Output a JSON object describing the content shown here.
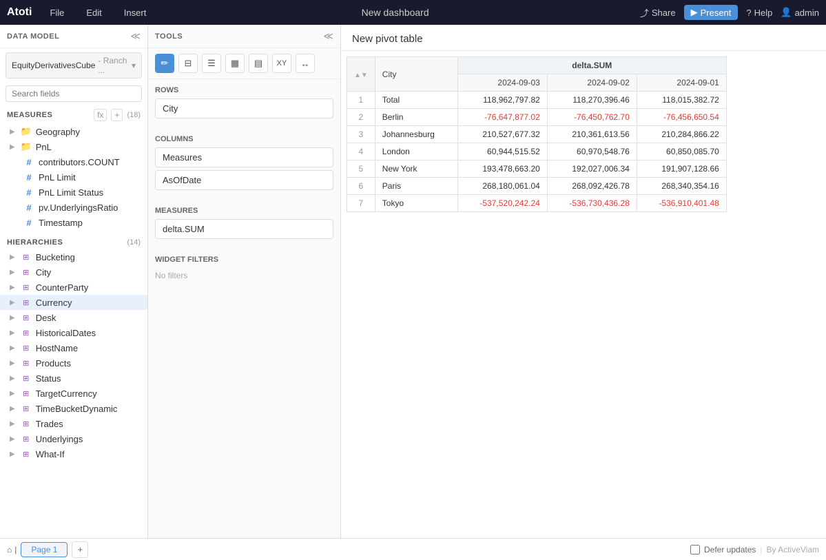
{
  "app": {
    "logo": "Atoti",
    "menu_items": [
      "File",
      "Edit",
      "Insert"
    ],
    "dashboard_title": "New dashboard",
    "share_label": "Share",
    "present_label": "Present",
    "help_label": "Help",
    "user_label": "admin"
  },
  "left_panel": {
    "title": "DATA MODEL",
    "cube_name": "EquityDerivativesCube",
    "cube_suffix": "- Ranch ...",
    "search_placeholder": "Search fields",
    "measures_section": {
      "label": "MEASURES",
      "count": "(18)",
      "fx_label": "fx",
      "plus_label": "+",
      "items": [
        {
          "type": "folder",
          "label": "Geography"
        },
        {
          "type": "folder",
          "label": "PnL"
        },
        {
          "type": "hash",
          "label": "contributors.COUNT"
        },
        {
          "type": "hash",
          "label": "PnL Limit"
        },
        {
          "type": "hash",
          "label": "PnL Limit Status"
        },
        {
          "type": "hash",
          "label": "pv.UnderlyingsRatio"
        },
        {
          "type": "hash",
          "label": "Timestamp"
        }
      ]
    },
    "hierarchies_section": {
      "label": "HIERARCHIES",
      "count": "(14)",
      "items": [
        {
          "type": "hierarchy",
          "label": "Bucketing"
        },
        {
          "type": "hierarchy",
          "label": "City"
        },
        {
          "type": "hierarchy",
          "label": "CounterParty"
        },
        {
          "type": "hierarchy",
          "label": "Currency",
          "highlighted": true
        },
        {
          "type": "hierarchy",
          "label": "Desk"
        },
        {
          "type": "hierarchy",
          "label": "HistoricalDates"
        },
        {
          "type": "hierarchy",
          "label": "HostName"
        },
        {
          "type": "hierarchy",
          "label": "Products"
        },
        {
          "type": "hierarchy",
          "label": "Status"
        },
        {
          "type": "hierarchy",
          "label": "TargetCurrency"
        },
        {
          "type": "hierarchy",
          "label": "TimeBucketDynamic"
        },
        {
          "type": "hierarchy",
          "label": "Trades"
        },
        {
          "type": "hierarchy",
          "label": "Underlyings"
        },
        {
          "type": "hierarchy",
          "label": "What-If"
        }
      ]
    }
  },
  "tools_panel": {
    "title": "TOOLS",
    "toolbar_buttons": [
      {
        "icon": "✏",
        "label": "edit-icon"
      },
      {
        "icon": "⊞",
        "label": "filter-icon"
      },
      {
        "icon": "⊟",
        "label": "filter2-icon"
      },
      {
        "icon": "⊠",
        "label": "chart-icon"
      },
      {
        "icon": "⊡",
        "label": "table-icon"
      },
      {
        "icon": "xy",
        "label": "xy-icon"
      },
      {
        "icon": "↔",
        "label": "expand-icon"
      }
    ],
    "rows_label": "Rows",
    "rows_value": "City",
    "columns_label": "Columns",
    "columns_items": [
      "Measures",
      "AsOfDate"
    ],
    "measures_label": "Measures",
    "measures_value": "delta.SUM",
    "widget_filters_label": "Widget filters",
    "no_filters": "No filters"
  },
  "pivot_table": {
    "title": "New pivot table",
    "col_city": "City",
    "col_delta": "delta.SUM",
    "dates": [
      "2024-09-03",
      "2024-09-02",
      "2024-09-01"
    ],
    "rows": [
      {
        "num": "1",
        "city": "Total",
        "v1": "118,962,797.82",
        "v2": "118,270,396.46",
        "v3": "118,015,382.72",
        "neg1": false,
        "neg2": false,
        "neg3": false
      },
      {
        "num": "2",
        "city": "Berlin",
        "v1": "-76,647,877.02",
        "v2": "-76,450,762.70",
        "v3": "-76,456,650.54",
        "neg1": true,
        "neg2": true,
        "neg3": true
      },
      {
        "num": "3",
        "city": "Johannesburg",
        "v1": "210,527,677.32",
        "v2": "210,361,613.56",
        "v3": "210,284,866.22",
        "neg1": false,
        "neg2": false,
        "neg3": false
      },
      {
        "num": "4",
        "city": "London",
        "v1": "60,944,515.52",
        "v2": "60,970,548.76",
        "v3": "60,850,085.70",
        "neg1": false,
        "neg2": false,
        "neg3": false
      },
      {
        "num": "5",
        "city": "New York",
        "v1": "193,478,663.20",
        "v2": "192,027,006.34",
        "v3": "191,907,128.66",
        "neg1": false,
        "neg2": false,
        "neg3": false
      },
      {
        "num": "6",
        "city": "Paris",
        "v1": "268,180,061.04",
        "v2": "268,092,426.78",
        "v3": "268,340,354.16",
        "neg1": false,
        "neg2": false,
        "neg3": false
      },
      {
        "num": "7",
        "city": "Tokyo",
        "v1": "-537,520,242.24",
        "v2": "-536,730,436.28",
        "v3": "-536,910,401.48",
        "neg1": true,
        "neg2": true,
        "neg3": true
      }
    ]
  },
  "bottom_bar": {
    "home_icon": "⌂",
    "page_label": "Page 1",
    "add_label": "+",
    "defer_label": "Defer updates",
    "by_label": "By ActiveViam"
  }
}
